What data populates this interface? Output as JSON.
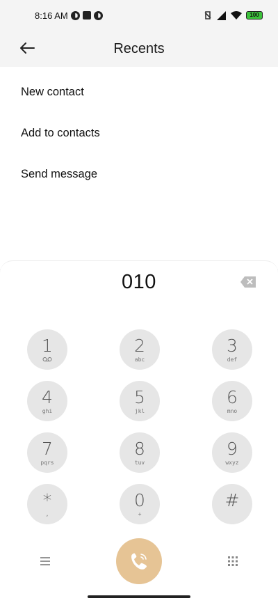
{
  "status_bar": {
    "time": "8:16 AM",
    "battery": "100"
  },
  "header": {
    "title": "Recents"
  },
  "options": [
    {
      "label": "New contact"
    },
    {
      "label": "Add to contacts"
    },
    {
      "label": "Send message"
    }
  ],
  "dialpad": {
    "number": "010",
    "keys": [
      {
        "digit": "1",
        "letters": ""
      },
      {
        "digit": "2",
        "letters": "abc"
      },
      {
        "digit": "3",
        "letters": "def"
      },
      {
        "digit": "4",
        "letters": "ghi"
      },
      {
        "digit": "5",
        "letters": "jkl"
      },
      {
        "digit": "6",
        "letters": "mno"
      },
      {
        "digit": "7",
        "letters": "pqrs"
      },
      {
        "digit": "8",
        "letters": "tuv"
      },
      {
        "digit": "9",
        "letters": "wxyz"
      },
      {
        "digit": "*",
        "letters": ","
      },
      {
        "digit": "0",
        "letters": "+"
      },
      {
        "digit": "#",
        "letters": ""
      }
    ]
  },
  "colors": {
    "call_button": "#e6c495",
    "key_background": "#e6e6e6",
    "battery": "#3cc13b"
  },
  "icons": [
    "back-arrow-icon",
    "backspace-icon",
    "voicemail-icon",
    "menu-icon",
    "phone-icon",
    "keypad-icon",
    "wifi-icon",
    "signal-icon"
  ]
}
